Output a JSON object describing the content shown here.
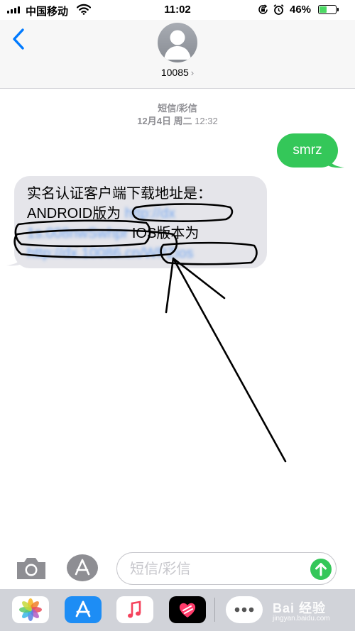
{
  "status_bar": {
    "carrier": "中国移动",
    "time": "11:02",
    "battery_percent_label": "46%",
    "battery_level": 0.46,
    "icons": [
      "signal-icon",
      "wifi-icon",
      "orientation-lock-icon",
      "alarm-icon",
      "battery-icon"
    ]
  },
  "header": {
    "back_icon": "chevron-left-icon",
    "contact": "10085",
    "contact_chevron": "›",
    "avatar_icon": "person-silhouette-icon"
  },
  "conversation": {
    "service_label": "短信/彩信",
    "date": "12月4日 周二",
    "time": "12:32",
    "outgoing": {
      "text": "smrz"
    },
    "incoming": {
      "line1": "实名认证客户端下载地址是：",
      "line2_prefix": "ANDROID版为",
      "ios_label": "IOS版本为"
    }
  },
  "input_bar": {
    "placeholder": "短信/彩信",
    "camera_icon": "camera-icon",
    "apps_icon": "app-store-icon",
    "send_icon": "send-arrow-icon"
  },
  "app_drawer": {
    "apps": [
      "photos-icon",
      "app-store-icon",
      "music-icon",
      "digital-touch-icon",
      "more-icon"
    ]
  },
  "watermark": {
    "text": "Bai 经验",
    "sub": "jingyan.baidu.com"
  },
  "colors": {
    "accent": "#007aff",
    "sms_green": "#34c759",
    "incoming_bubble": "#e5e5ea",
    "link": "#4a8ff0"
  }
}
